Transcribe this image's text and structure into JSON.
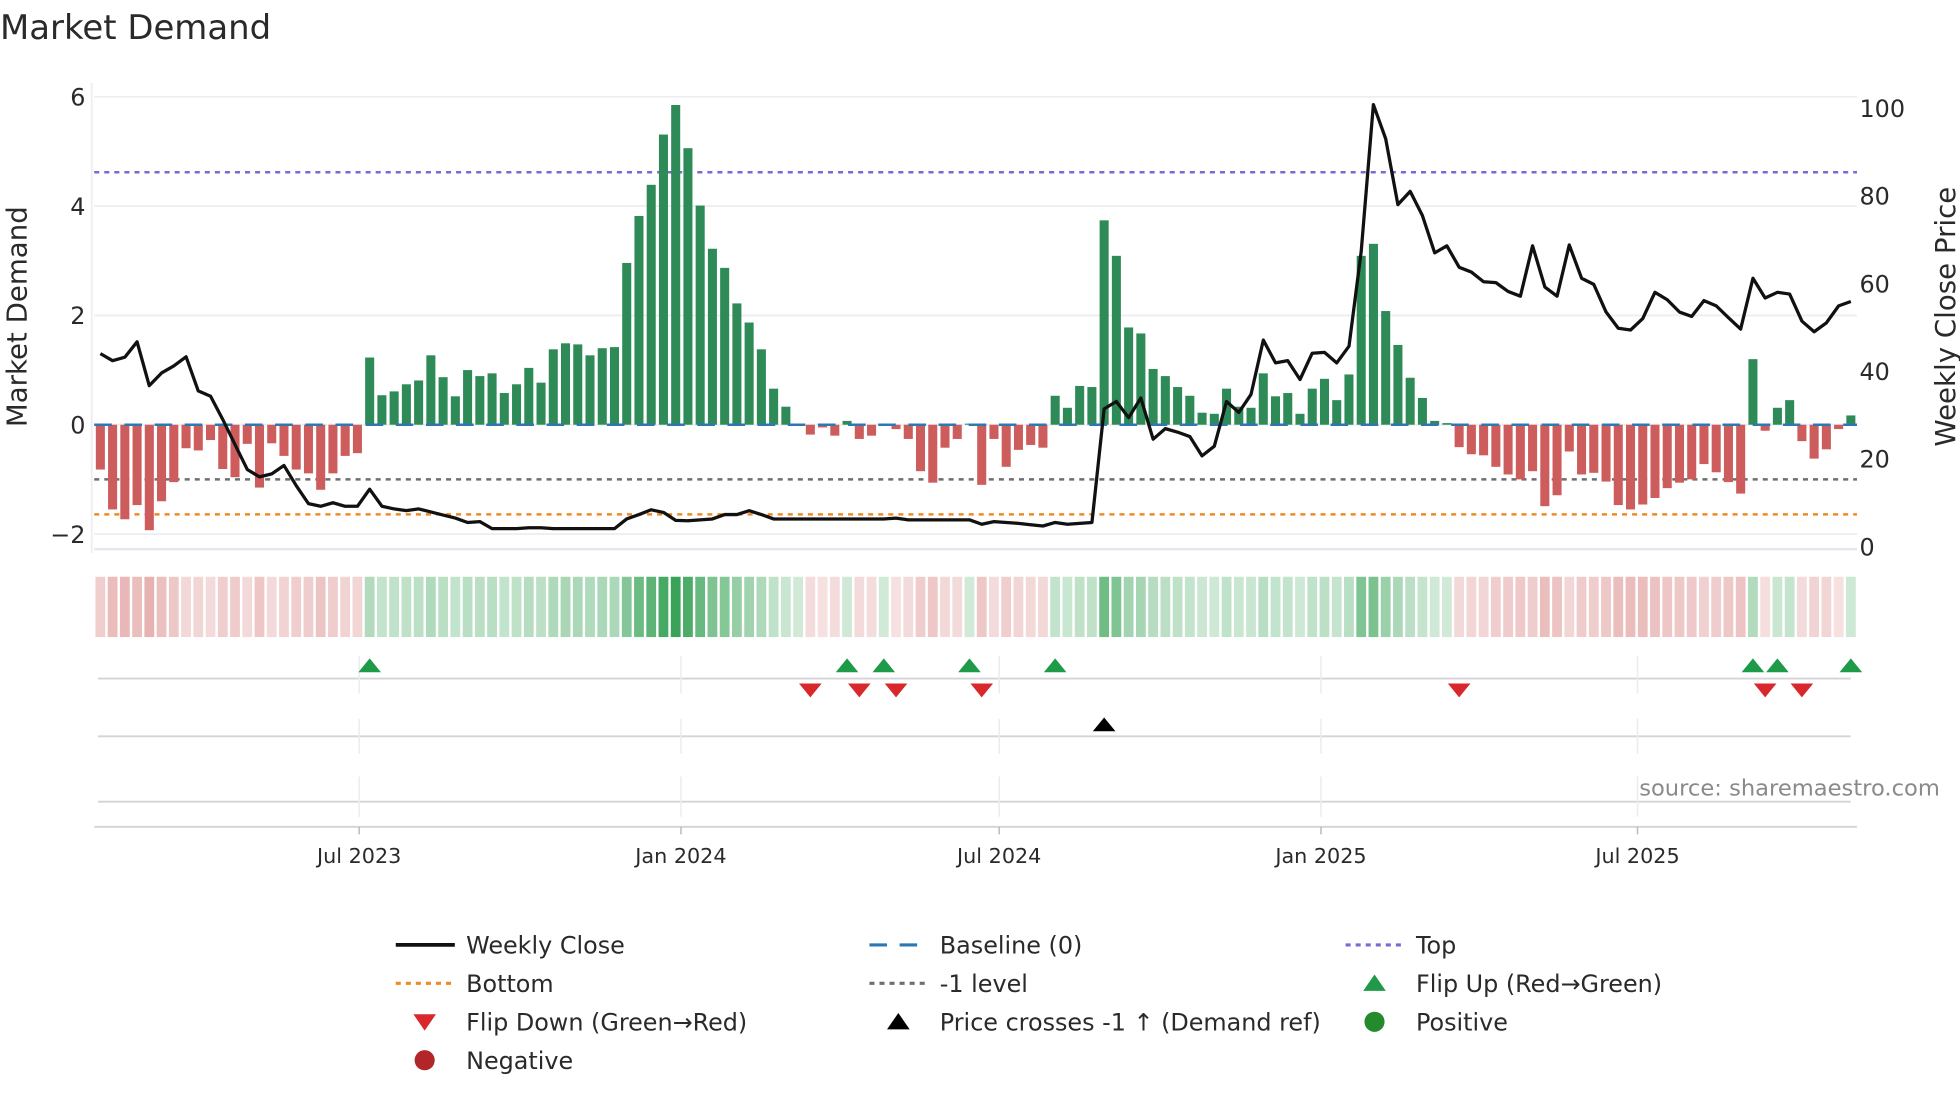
{
  "chart_data": {
    "type": "bar",
    "title": "Market Demand",
    "ylabel": "Market Demand",
    "y2label": "Weekly Close Price",
    "ylim": [
      -2.28,
      6.25
    ],
    "y2lim": [
      0,
      100
    ],
    "yticks": [
      "6",
      "4",
      "2",
      "0",
      "−2"
    ],
    "yticks_values": [
      6,
      4,
      2,
      0,
      -2
    ],
    "y2ticks": [
      "100",
      "80",
      "60",
      "40",
      "20",
      "0"
    ],
    "y2ticks_values": [
      100,
      80,
      60,
      40,
      20,
      0
    ],
    "xticks": [
      {
        "label": "Jul 2023",
        "date": "2023-07-01"
      },
      {
        "label": "Jan 2024",
        "date": "2024-01-01"
      },
      {
        "label": "Jul 2024",
        "date": "2024-07-01"
      },
      {
        "label": "Jan 2025",
        "date": "2025-01-01"
      },
      {
        "label": "Jul 2025",
        "date": "2025-07-01"
      }
    ],
    "start_week": "2023-02-03",
    "interval_days": 7,
    "reference_lines": {
      "top": 4.62,
      "baseline": 0,
      "minus_one": -1,
      "bottom": -1.64
    },
    "demand": [
      -0.82,
      -1.55,
      -1.73,
      -1.47,
      -1.93,
      -1.4,
      -1.05,
      -0.43,
      -0.47,
      -0.28,
      -0.81,
      -0.96,
      -0.35,
      -1.15,
      -0.34,
      -0.57,
      -0.82,
      -0.89,
      -1.19,
      -0.89,
      -0.57,
      -0.52,
      1.23,
      0.54,
      0.61,
      0.74,
      0.81,
      1.27,
      0.87,
      0.52,
      1.0,
      0.89,
      0.94,
      0.58,
      0.74,
      1.04,
      0.77,
      1.38,
      1.49,
      1.47,
      1.27,
      1.4,
      1.42,
      2.96,
      3.82,
      4.39,
      5.31,
      5.85,
      5.06,
      4.01,
      3.22,
      2.87,
      2.22,
      1.87,
      1.38,
      0.66,
      0.33,
      0.01,
      -0.18,
      -0.05,
      -0.2,
      0.07,
      -0.26,
      -0.2,
      0.02,
      -0.08,
      -0.26,
      -0.85,
      -1.06,
      -0.42,
      -0.26,
      0.02,
      -1.1,
      -0.26,
      -0.77,
      -0.46,
      -0.37,
      -0.42,
      0.53,
      0.31,
      0.71,
      0.69,
      3.74,
      3.09,
      1.78,
      1.67,
      1.02,
      0.89,
      0.69,
      0.53,
      0.22,
      0.2,
      0.66,
      0.33,
      0.31,
      0.94,
      0.52,
      0.58,
      0.2,
      0.66,
      0.84,
      0.45,
      0.92,
      3.09,
      3.31,
      2.08,
      1.46,
      0.86,
      0.49,
      0.07,
      0.03,
      -0.41,
      -0.54,
      -0.56,
      -0.77,
      -0.91,
      -1.0,
      -0.85,
      -1.49,
      -1.29,
      -0.49,
      -0.91,
      -0.88,
      -1.04,
      -1.47,
      -1.55,
      -1.46,
      -1.34,
      -1.16,
      -1.06,
      -1.0,
      -0.72,
      -0.87,
      -1.05,
      -1.26,
      1.2,
      -0.11,
      0.31,
      0.45,
      -0.3,
      -0.62,
      -0.45,
      -0.08,
      0.17
    ],
    "weekly_close": [
      44,
      42.4,
      43.2,
      46.7,
      36.7,
      39.6,
      41.2,
      43.3,
      35.5,
      34.3,
      29,
      23.3,
      17.6,
      15.9,
      16.6,
      18.5,
      13.9,
      9.8,
      9.2,
      10,
      9.2,
      9.2,
      13.1,
      9.2,
      8.6,
      8.2,
      8.6,
      7.9,
      7.2,
      6.5,
      5.5,
      5.7,
      4.1,
      4.1,
      4.1,
      4.3,
      4.3,
      4.1,
      4.1,
      4.1,
      4.1,
      4.1,
      4.1,
      6.3,
      7.3,
      8.4,
      7.8,
      6,
      5.9,
      6.1,
      6.3,
      7.3,
      7.3,
      8.2,
      7.3,
      6.3,
      6.3,
      6.3,
      6.3,
      6.3,
      6.3,
      6.3,
      6.3,
      6.3,
      6.3,
      6.5,
      6.1,
      6.1,
      6.1,
      6.1,
      6.1,
      6.1,
      5.1,
      5.7,
      5.5,
      5.3,
      5.0,
      4.7,
      5.5,
      5.1,
      5.3,
      5.5,
      31.4,
      33.1,
      29.4,
      33.9,
      24.5,
      26.9,
      26.1,
      25.1,
      20.7,
      22.9,
      33.1,
      30.6,
      34.7,
      47.1,
      41.9,
      42.4,
      38.1,
      44.1,
      44.3,
      41.9,
      45.7,
      67.3,
      100.8,
      93,
      78,
      81,
      75.5,
      67,
      68.6,
      63.7,
      62.6,
      60.4,
      60.2,
      58.2,
      57.1,
      68.6,
      59.2,
      57.1,
      68.8,
      61.2,
      59.8,
      53.5,
      49.8,
      49.4,
      52,
      58,
      56.3,
      53.5,
      52.5,
      56.1,
      54.9,
      52.2,
      49.6,
      61.2,
      56.7,
      58,
      57.6,
      51.4,
      49,
      51,
      54.9,
      55.9
    ],
    "flip_up_weeks": [
      23,
      62,
      65,
      72,
      79,
      136,
      138,
      144
    ],
    "flip_down_weeks": [
      59,
      63,
      66,
      73,
      112,
      137,
      140
    ],
    "price_cross_weeks": [
      83
    ],
    "legend": [
      {
        "label": "Weekly Close",
        "kind": "line",
        "color": "#111111"
      },
      {
        "label": "Baseline (0)",
        "kind": "dash",
        "color": "#2f77b0"
      },
      {
        "label": "Top",
        "kind": "dot",
        "color": "#7d68d4"
      },
      {
        "label": "Bottom",
        "kind": "dot",
        "color": "#f08a24"
      },
      {
        "label": "-1 level",
        "kind": "dot",
        "color": "#6e6e6e"
      },
      {
        "label": "Flip Up (Red→Green)",
        "kind": "tri-up",
        "color": "#1e9a48"
      },
      {
        "label": "Flip Down (Green→Red)",
        "kind": "tri-down",
        "color": "#d9282c"
      },
      {
        "label": "Price crosses -1 ↑ (Demand ref)",
        "kind": "tri-up",
        "color": "#000000"
      },
      {
        "label": "Positive",
        "kind": "circle",
        "color": "#248a2c"
      },
      {
        "label": "Negative",
        "kind": "circle",
        "color": "#b2262a"
      }
    ],
    "legend_placement": "bottom",
    "colors": {
      "positive_bar": "#2e8b57",
      "negative_bar": "#cd5c5c",
      "top": "#7d68d4",
      "bottom": "#f08a24",
      "minus_one": "#6e6e6e",
      "baseline": "#2f77b0"
    }
  },
  "source": "source: sharemaestro.com"
}
